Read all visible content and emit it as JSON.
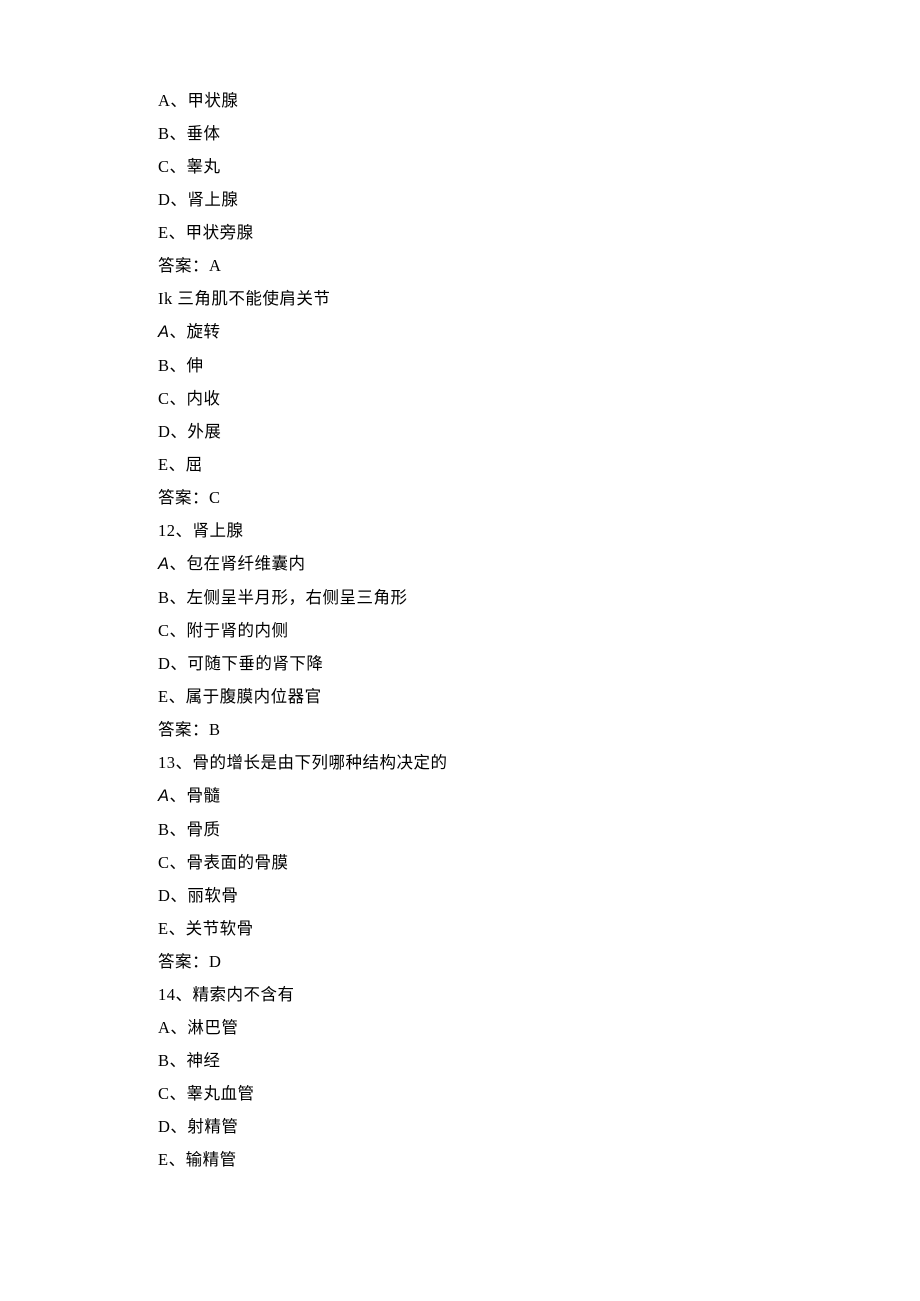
{
  "q10": {
    "optA": "A、甲状腺",
    "optB": "B、垂体",
    "optC": "C、睾丸",
    "optD": "D、肾上腺",
    "optE": "E、甲状旁腺",
    "answer": "答案：A"
  },
  "q11": {
    "stem": "Ik 三角肌不能使肩关节",
    "optA_letter": "A",
    "optA_rest": "、旋转",
    "optB": "B、伸",
    "optC": "C、内收",
    "optD": "D、外展",
    "optE": "E、屈",
    "answer": "答案：C"
  },
  "q12": {
    "stem": "12、肾上腺",
    "optA_letter": "A",
    "optA_rest": "、包在肾纤维囊内",
    "optB": "B、左侧呈半月形，右侧呈三角形",
    "optC": "C、附于肾的内侧",
    "optD": "D、可随下垂的肾下降",
    "optE": "E、属于腹膜内位器官",
    "answer": "答案：B"
  },
  "q13": {
    "stem": "13、骨的增长是由下列哪种结构决定的",
    "optA_letter": "A",
    "optA_rest": "、骨髓",
    "optB": "B、骨质",
    "optC": "C、骨表面的骨膜",
    "optD": "D、丽软骨",
    "optE": "E、关节软骨",
    "answer": "答案：D"
  },
  "q14": {
    "stem": "14、精索内不含有",
    "optA": "A、淋巴管",
    "optB": "B、神经",
    "optC": "C、睾丸血管",
    "optD": "D、射精管",
    "optE": "E、输精管"
  }
}
